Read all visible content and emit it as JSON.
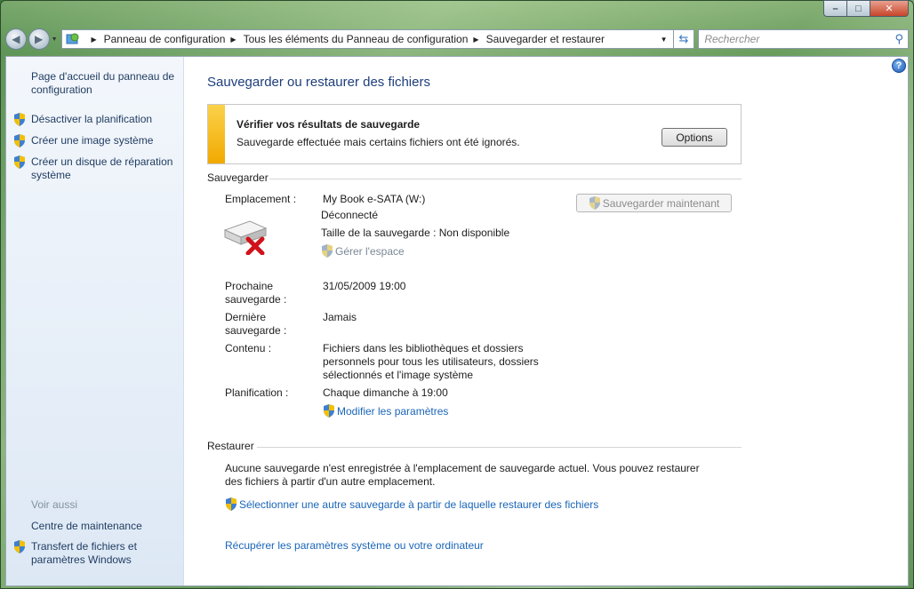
{
  "window": {
    "minimize_glyph": "–",
    "maximize_glyph": "□",
    "close_glyph": "✕"
  },
  "nav": {
    "back_icon": "back-arrow",
    "forward_icon": "forward-arrow",
    "breadcrumbs": [
      "Panneau de configuration",
      "Tous les éléments du Panneau de configuration",
      "Sauvegarder et restaurer"
    ],
    "search_placeholder": "Rechercher"
  },
  "sidebar": {
    "home_link": "Page d'accueil du panneau de configuration",
    "tasks": [
      {
        "label": "Désactiver la planification",
        "icon": "shield-icon"
      },
      {
        "label": "Créer une image système",
        "icon": "shield-icon"
      },
      {
        "label": "Créer un disque de réparation système",
        "icon": "shield-icon"
      }
    ],
    "see_also_title": "Voir aussi",
    "see_also": [
      {
        "label": "Centre de maintenance"
      },
      {
        "label": "Transfert de fichiers et paramètres Windows",
        "icon": "shield-icon"
      }
    ]
  },
  "main": {
    "title": "Sauvegarder ou restaurer des fichiers",
    "notice": {
      "title": "Vérifier vos résultats de sauvegarde",
      "text": "Sauvegarde effectuée mais certains fichiers ont été ignorés.",
      "button": "Options",
      "accent": "#f5b400"
    },
    "backup": {
      "section": "Sauvegarder",
      "location_label": "Emplacement :",
      "location_value": "My Book e-SATA (W:)",
      "status": "Déconnecté",
      "size": "Taille de la sauvegarde : Non disponible",
      "manage_space": "Gérer l'espace",
      "backup_now": "Sauvegarder maintenant",
      "next_label": "Prochaine sauvegarde :",
      "next_value": "31/05/2009 19:00",
      "last_label": "Dernière sauvegarde :",
      "last_value": "Jamais",
      "contents_label": "Contenu :",
      "contents_value": "Fichiers dans les bibliothèques et dossiers personnels pour tous les utilisateurs, dossiers sélectionnés et l'image système",
      "schedule_label": "Planification :",
      "schedule_value": "Chaque dimanche à 19:00",
      "change_settings": "Modifier les paramètres"
    },
    "restore": {
      "section": "Restaurer",
      "text": "Aucune sauvegarde n'est enregistrée à l'emplacement de sauvegarde actuel. Vous pouvez restaurer des fichiers à partir d'un autre emplacement.",
      "select_other": "Sélectionner une autre sauvegarde à partir de laquelle restaurer des fichiers",
      "recover": "Récupérer les paramètres système ou votre ordinateur"
    }
  }
}
